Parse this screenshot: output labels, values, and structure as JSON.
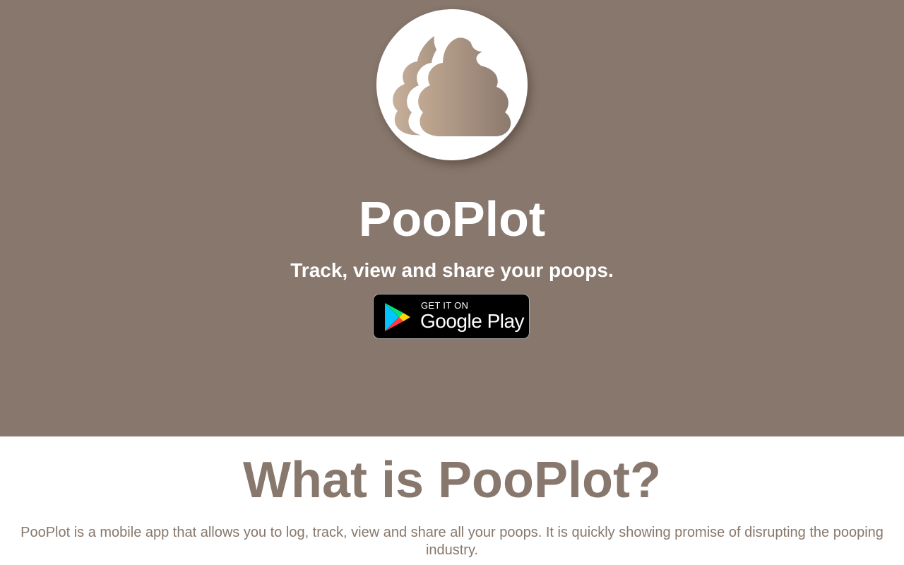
{
  "colors": {
    "brand": "#87776c",
    "hero_text": "#ffffff",
    "badge_background": "#000000"
  },
  "hero": {
    "logo_icon": "poop-icon",
    "title": "PooPlot",
    "tagline": "Track, view and share your poops.",
    "store_badge": {
      "icon": "google-play-icon",
      "small_text": "GET IT ON",
      "big_text": "Google Play"
    }
  },
  "about": {
    "heading": "What is PooPlot?",
    "description": "PooPlot is a mobile app that allows you to log, track, view and share all your poops. It is quickly showing promise of disrupting the pooping industry."
  }
}
